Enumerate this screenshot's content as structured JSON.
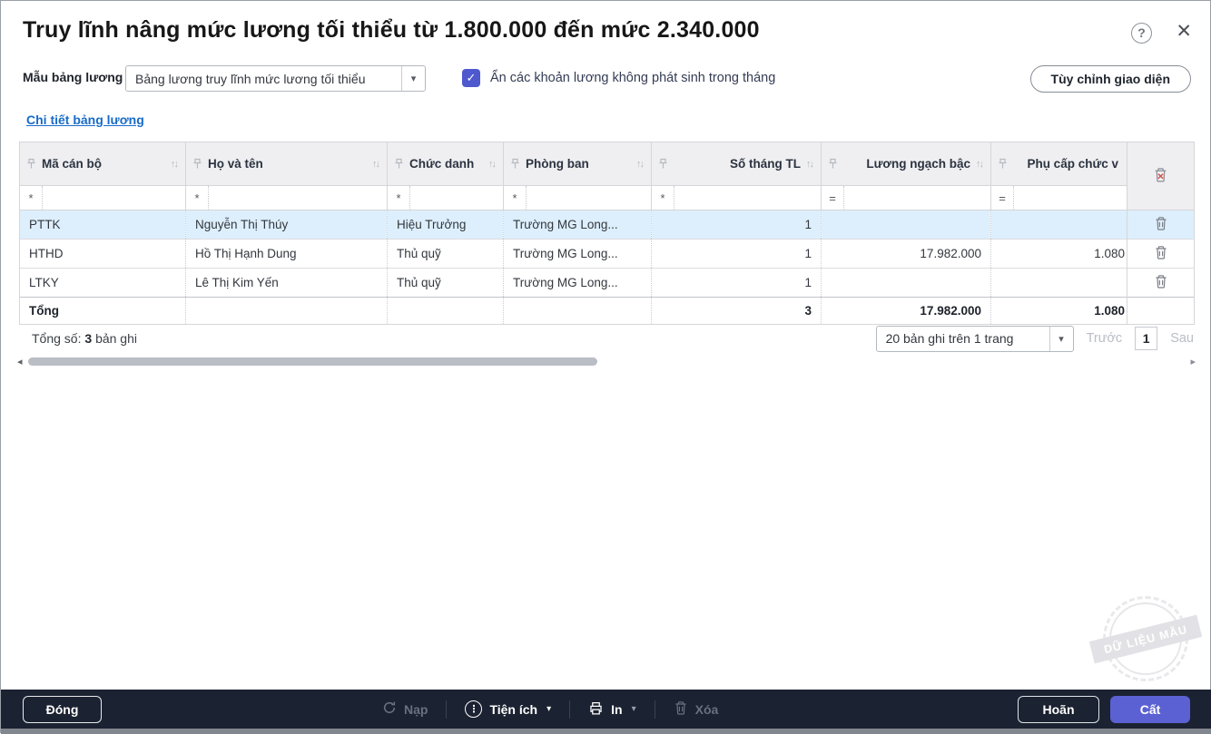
{
  "header": {
    "title": "Truy lĩnh nâng mức lương tối thiểu từ 1.800.000 đến mức 2.340.000"
  },
  "toolbar": {
    "template_label": "Mẫu bảng lương",
    "template_value": "Bảng lương truy lĩnh mức lương tối thiểu",
    "checkbox_label": "Ẩn các khoản lương không phát sinh trong tháng",
    "customize_button": "Tùy chỉnh giao diện"
  },
  "section": {
    "detail_link": "Chi tiết bảng lương"
  },
  "table": {
    "columns": [
      {
        "label": "Mã cán bộ",
        "filter_op": "*"
      },
      {
        "label": "Họ và tên",
        "filter_op": "*"
      },
      {
        "label": "Chức danh",
        "filter_op": "*"
      },
      {
        "label": "Phòng ban",
        "filter_op": "*"
      },
      {
        "label": "Số tháng TL",
        "filter_op": "*"
      },
      {
        "label": "Lương ngạch bậc",
        "filter_op": "="
      },
      {
        "label": "Phụ cấp chức v",
        "filter_op": "="
      }
    ],
    "rows": [
      {
        "code": "PTTK",
        "name": "Nguyễn Thị Thúy",
        "title": "Hiệu Trưởng",
        "dept": "Trường MG Long...",
        "months": "1",
        "base": "",
        "allowance": ""
      },
      {
        "code": "HTHD",
        "name": "Hồ Thị Hạnh Dung",
        "title": "Thủ quỹ",
        "dept": "Trường MG Long...",
        "months": "1",
        "base": "17.982.000",
        "allowance": "1.080"
      },
      {
        "code": "LTKY",
        "name": "Lê Thị Kim Yến",
        "title": "Thủ quỹ",
        "dept": "Trường MG Long...",
        "months": "1",
        "base": "",
        "allowance": ""
      }
    ],
    "total": {
      "label": "Tổng",
      "months": "3",
      "base": "17.982.000",
      "allowance": "1.080"
    }
  },
  "pagination": {
    "summary_prefix": "Tổng số:",
    "summary_count": "3",
    "summary_suffix": "bản ghi",
    "page_size_value": "20 bản ghi trên 1 trang",
    "prev_label": "Trước",
    "current_page": "1",
    "next_label": "Sau"
  },
  "footer": {
    "close_button": "Đóng",
    "load_button": "Nạp",
    "utilities_button": "Tiện ích",
    "print_button": "In",
    "delete_button": "Xóa",
    "defer_button": "Hoãn",
    "save_button": "Cất"
  },
  "watermark": {
    "text": "DỮ LIỆU MẪU"
  },
  "icons": {
    "help": "?",
    "close": "✕",
    "caret_down": "▾",
    "sort": "↑↓",
    "check": "✓",
    "dots_vertical": "⋮",
    "scroll_left": "◂",
    "scroll_right": "▸"
  },
  "colors": {
    "accent": "#4d59cd",
    "save_button": "#5b61d2",
    "link": "#186bc9",
    "selected_row": "#ddeffc",
    "footer_bg": "#1b2231",
    "header_bg": "#efeff1"
  }
}
